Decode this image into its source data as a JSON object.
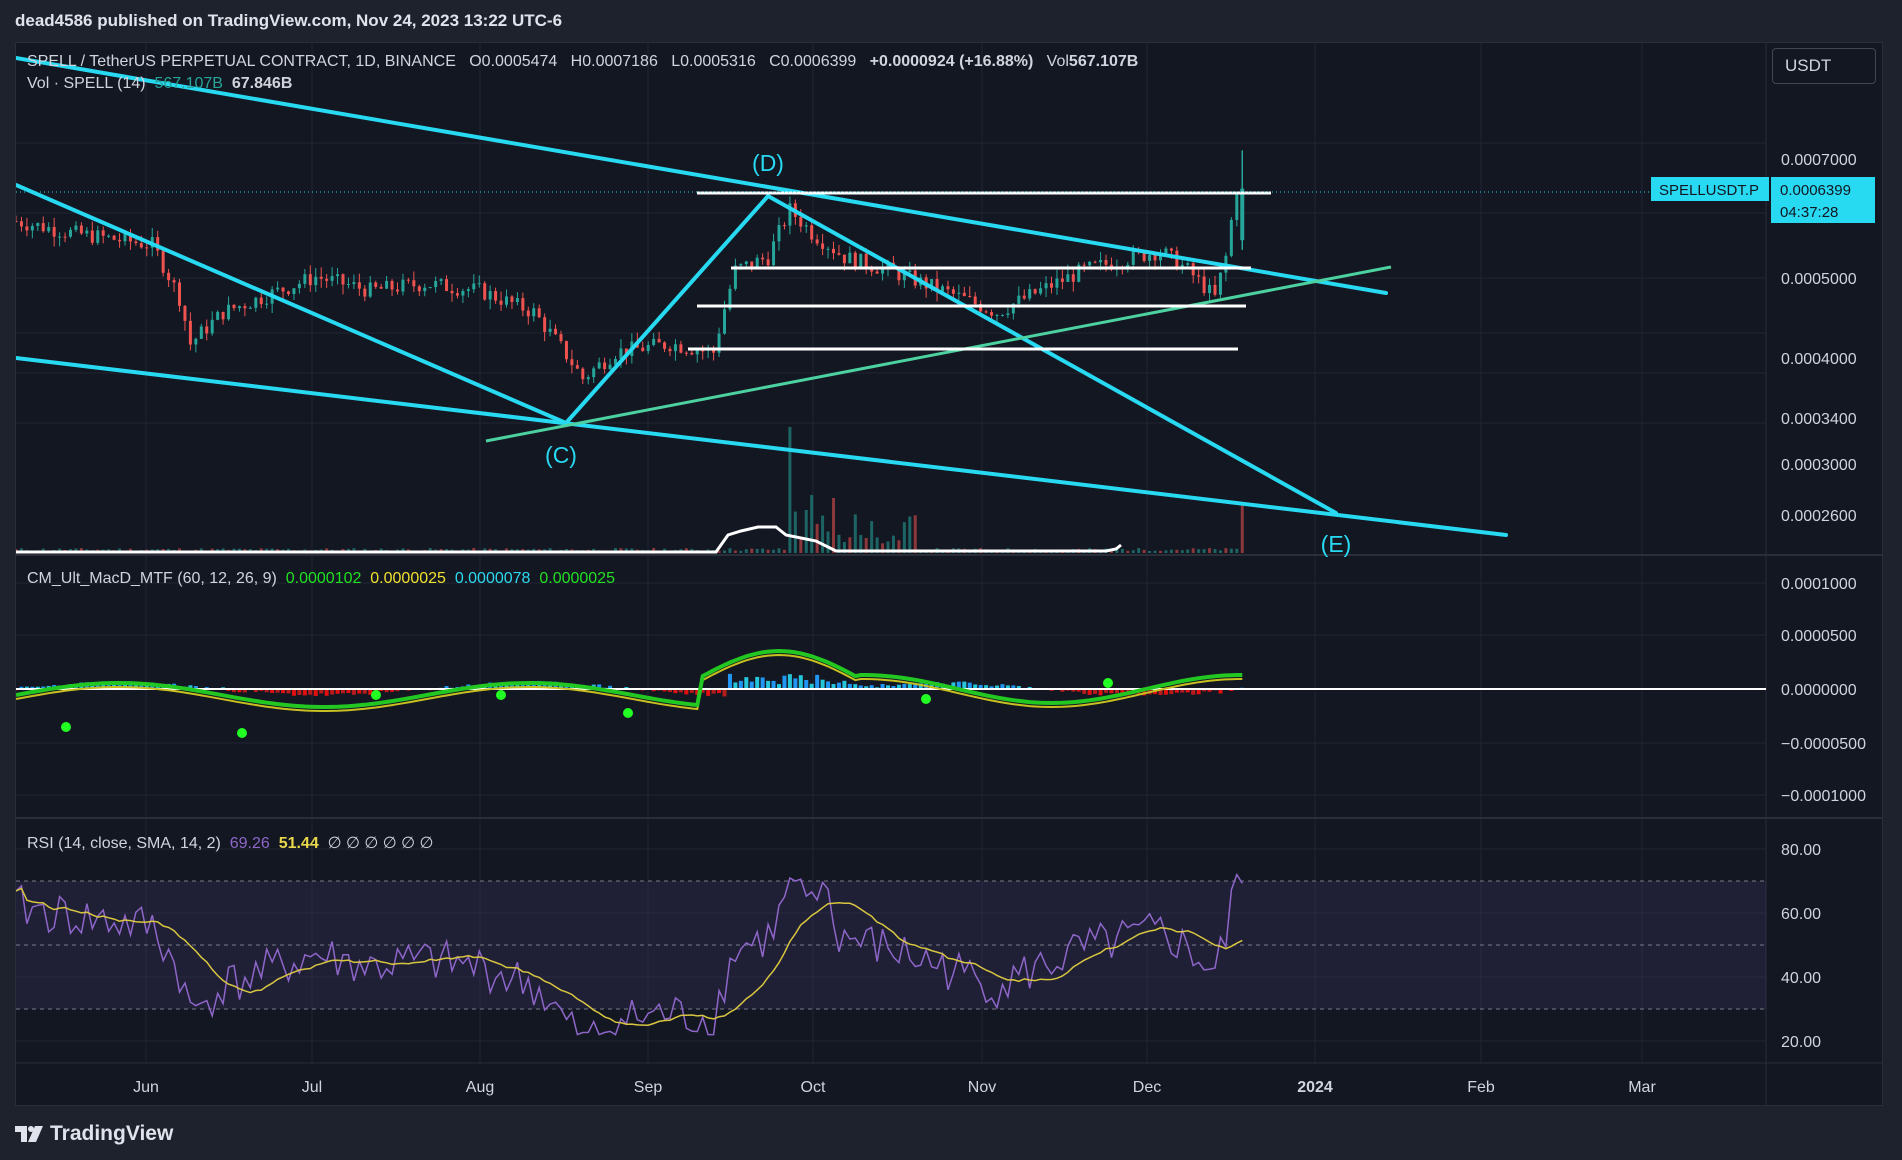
{
  "header": {
    "published": "dead4586 published on TradingView.com, Nov 24, 2023 13:22 UTC-6"
  },
  "currency_button": "USDT",
  "footer": {
    "brand": "TradingView"
  },
  "colors": {
    "background": "#131722",
    "up": "#26a69a",
    "down": "#ef5350",
    "trendline": "#28d9f2",
    "support_line": "#4cd1a0",
    "level_line": "#ffffff",
    "rsi": "#8e66c9",
    "rsi_sma": "#d8c640",
    "macd_green": "#22c722",
    "macd_red": "#e01010",
    "macd_signal": "#c8c020"
  },
  "legend": {
    "symbol": "SPELL / TetherUS PERPETUAL CONTRACT, 1D, BINANCE",
    "o_label": "O",
    "o": "0.0005474",
    "h_label": "H",
    "h": "0.0007186",
    "l_label": "L",
    "l": "0.0005316",
    "c_label": "C",
    "c": "0.0006399",
    "change": "+0.0000924 (+16.88%)",
    "vol_label": "Vol",
    "vol": "567.107B",
    "vol_indicator": "Vol · SPELL (14)",
    "vol_value": "567.107B",
    "vol_ma": "67.846B"
  },
  "macd_legend": {
    "name": "CM_Ult_MacD_MTF (60, 12, 26, 9)",
    "v1": "0.0000102",
    "v2": "0.0000025",
    "v3": "0.0000078",
    "v4": "0.0000025"
  },
  "rsi_legend": {
    "name": "RSI (14, close, SMA, 14, 2)",
    "rsi": "69.26",
    "sma": "51.44",
    "extra": "∅ ∅ ∅ ∅ ∅ ∅"
  },
  "price_tag": {
    "symbol": "SPELLUSDT.P",
    "price": "0.0006399",
    "countdown": "04:37:28"
  },
  "chart_data": {
    "type": "candlestick",
    "symbol": "SPELLUSDT.P",
    "interval": "1D",
    "scale": "log",
    "price_axis_ticks": [
      "0.0007000",
      "0.0005000",
      "0.0004000",
      "0.0003400",
      "0.0003000",
      "0.0002600"
    ],
    "macd_axis_ticks": [
      "0.0001000",
      "0.0000500",
      "0.0000000",
      "−0.0000500",
      "−0.0001000"
    ],
    "rsi_axis_ticks": [
      "80.00",
      "60.00",
      "40.00",
      "20.00"
    ],
    "time_axis_ticks": [
      "Jun",
      "Jul",
      "Aug",
      "Sep",
      "Oct",
      "Nov",
      "Dec",
      "2024",
      "Feb",
      "Mar"
    ],
    "last_candle": {
      "open": 0.0005474,
      "high": 0.0007186,
      "low": 0.0005316,
      "close": 0.0006399,
      "volume": "567.107B"
    },
    "annotations": [
      {
        "label": "(C)",
        "date": "2023-08-17",
        "price": 0.000342
      },
      {
        "label": "(D)",
        "date": "2023-09-23",
        "price": 0.000605
      },
      {
        "label": "(E)",
        "date": "2024-01-07",
        "price": 0.000265
      }
    ],
    "horizontal_levels": [
      0.000605,
      0.00052,
      0.000475,
      0.000412
    ],
    "rsi_levels": [
      70,
      50,
      30
    ],
    "rsi_last": 69.26,
    "rsi_sma_last": 51.44
  }
}
